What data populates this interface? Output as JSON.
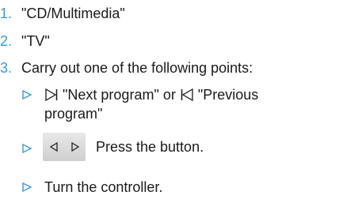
{
  "steps": [
    {
      "number": "1.",
      "text": "\"CD/Multimedia\""
    },
    {
      "number": "2.",
      "text": "\"TV\""
    },
    {
      "number": "3.",
      "text": "Carry out one of the following points:"
    }
  ],
  "options": {
    "program_line1_a": "\"Next program\" or",
    "program_line1_b": "\"Previous",
    "program_line2": "program\"",
    "press_button": "Press the button.",
    "turn_controller": "Turn the controller."
  },
  "colors": {
    "accent": "#3a9ad9",
    "text": "#1a1a1a"
  },
  "icons": {
    "bullet": "triangle-bullet-icon",
    "next": "skip-next-icon",
    "previous": "skip-previous-icon",
    "hardware_button": "seek-rocker-button"
  }
}
